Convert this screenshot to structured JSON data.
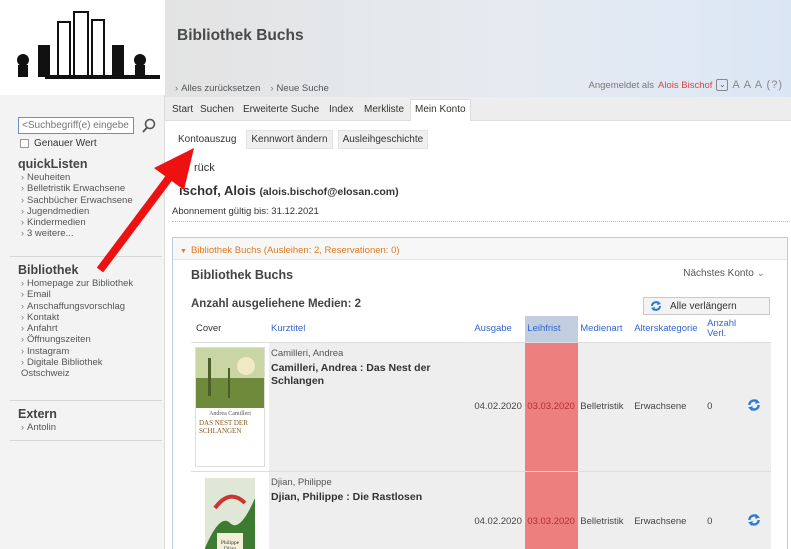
{
  "library_name": "Bibliothek Buchs",
  "breadcrumbs": [
    "Alles zurücksetzen",
    "Neue Suche"
  ],
  "login": {
    "prefix": "Angemeldet als",
    "user": "Alois Bischof",
    "font_sizes": "A A A (?)"
  },
  "search": {
    "placeholder": "<Suchbegriff(e) eingebe",
    "exact_label": "Genauer Wert"
  },
  "sidebar": {
    "quicklisten": {
      "title": "quickListen",
      "items": [
        "Neuheiten",
        "Belletristik Erwachsene",
        "Sachbücher Erwachsene",
        "Jugendmedien",
        "Kindermedien",
        "3 weitere..."
      ]
    },
    "bibliothek": {
      "title": "Bibliothek",
      "items": [
        "Homepage zur Bibliothek",
        "Email",
        "Anschaffungsvorschlag",
        "Kontakt",
        "Anfahrt",
        "Öffnungszeiten",
        "Instagram",
        "Digitale Bibliothek Ostschweiz"
      ]
    },
    "extern": {
      "title": "Extern",
      "items": [
        "Antolin"
      ]
    }
  },
  "tabs": [
    "Start",
    "Suchen",
    "Erweiterte Suche",
    "Index",
    "Merkliste",
    "Mein Konto"
  ],
  "subtabs": [
    "Kontoauszug",
    "Kennwort ändern",
    "Ausleihgeschichte"
  ],
  "account": {
    "back": "zurück",
    "back_visible": "rück",
    "name": "Bischof, Alois",
    "name_visible": "ischof, Alois",
    "email": "(alois.bischof@elosan.com)",
    "subscription": "Abonnement gültig bis: 31.12.2021"
  },
  "panel": {
    "header": "Bibliothek Buchs (Ausleihen: 2, Reservationen: 0)",
    "title": "Bibliothek Buchs",
    "next_account": "Nächstes Konto",
    "count": "Anzahl ausgeliehene Medien: 2",
    "renew_all": "Alle verlängern"
  },
  "table": {
    "headers": {
      "cover": "Cover",
      "title": "Kurztitel",
      "issued": "Ausgabe",
      "due": "Leihfrist",
      "media": "Medienart",
      "age": "Alterskategorie",
      "renewals": "Anzahl Verl."
    },
    "rows": [
      {
        "author": "Camilleri, Andrea",
        "title": "Camilleri, Andrea : Das Nest der Schlangen",
        "issued": "04.02.2020",
        "due": "03.03.2020",
        "media": "Belletristik",
        "age": "Erwachsene",
        "renewals": "0",
        "cover_author": "Andrea Camilleri",
        "cover_title": "DAS NEST DER SCHLANGEN"
      },
      {
        "author": "Djian, Philippe",
        "title": "Djian, Philippe : Die Rastlosen",
        "issued": "04.02.2020",
        "due": "03.03.2020",
        "media": "Belletristik",
        "age": "Erwachsene",
        "renewals": "0",
        "cover_author": "Philippe Djian"
      }
    ]
  },
  "colors": {
    "due_highlight": "#ee7f7f",
    "link": "#3366cc",
    "panel_accent": "#e07a1e",
    "user": "#dd4444",
    "arrow": "#ee1111"
  }
}
